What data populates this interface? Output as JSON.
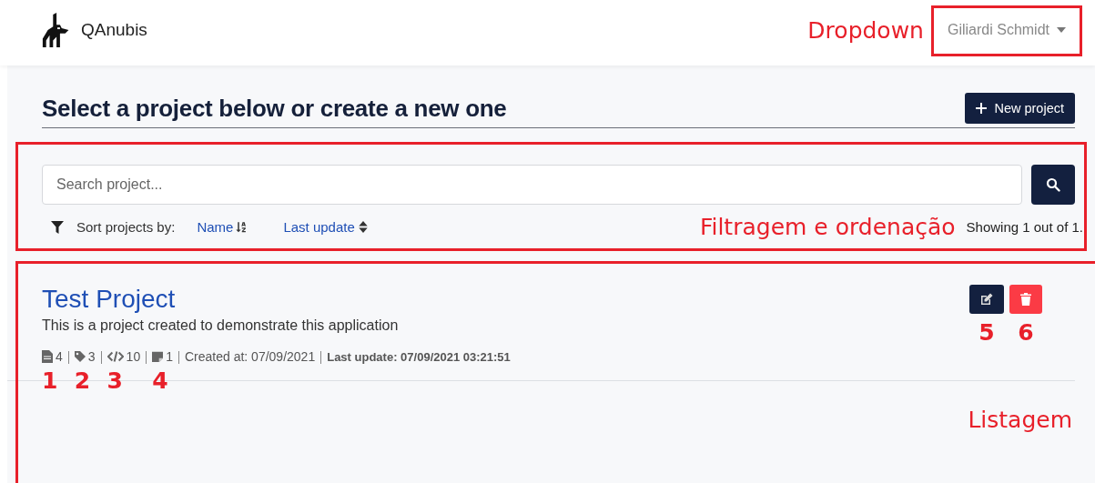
{
  "brand": {
    "name": "QAnubis"
  },
  "user_menu": {
    "label": "Giliardi Schmidt",
    "callout": "Dropdown"
  },
  "heading": "Select a project below or create a new one",
  "new_project_button": "New project",
  "filter": {
    "callout": "Filtragem e ordenação",
    "search": {
      "placeholder": "Search project..."
    },
    "sort_label": "Sort projects by:",
    "sort_options": [
      {
        "label": "Name",
        "active": true
      },
      {
        "label": "Last update",
        "active": false
      }
    ],
    "result_count": "Showing 1 out of 1."
  },
  "listing": {
    "callout": "Listagem",
    "projects": [
      {
        "title": "Test Project",
        "description": "This is a project created to demonstrate this application",
        "stats": [
          {
            "kind": "files",
            "value": "4",
            "callout": "1"
          },
          {
            "kind": "tags",
            "value": "3",
            "callout": "2"
          },
          {
            "kind": "code",
            "value": "10",
            "callout": "3"
          },
          {
            "kind": "notes",
            "value": "1",
            "callout": "4"
          }
        ],
        "created": "Created at: 07/09/2021",
        "updated": "Last update: 07/09/2021 03:21:51",
        "actions": [
          {
            "kind": "edit",
            "callout": "5"
          },
          {
            "kind": "delete",
            "callout": "6"
          }
        ]
      }
    ]
  }
}
